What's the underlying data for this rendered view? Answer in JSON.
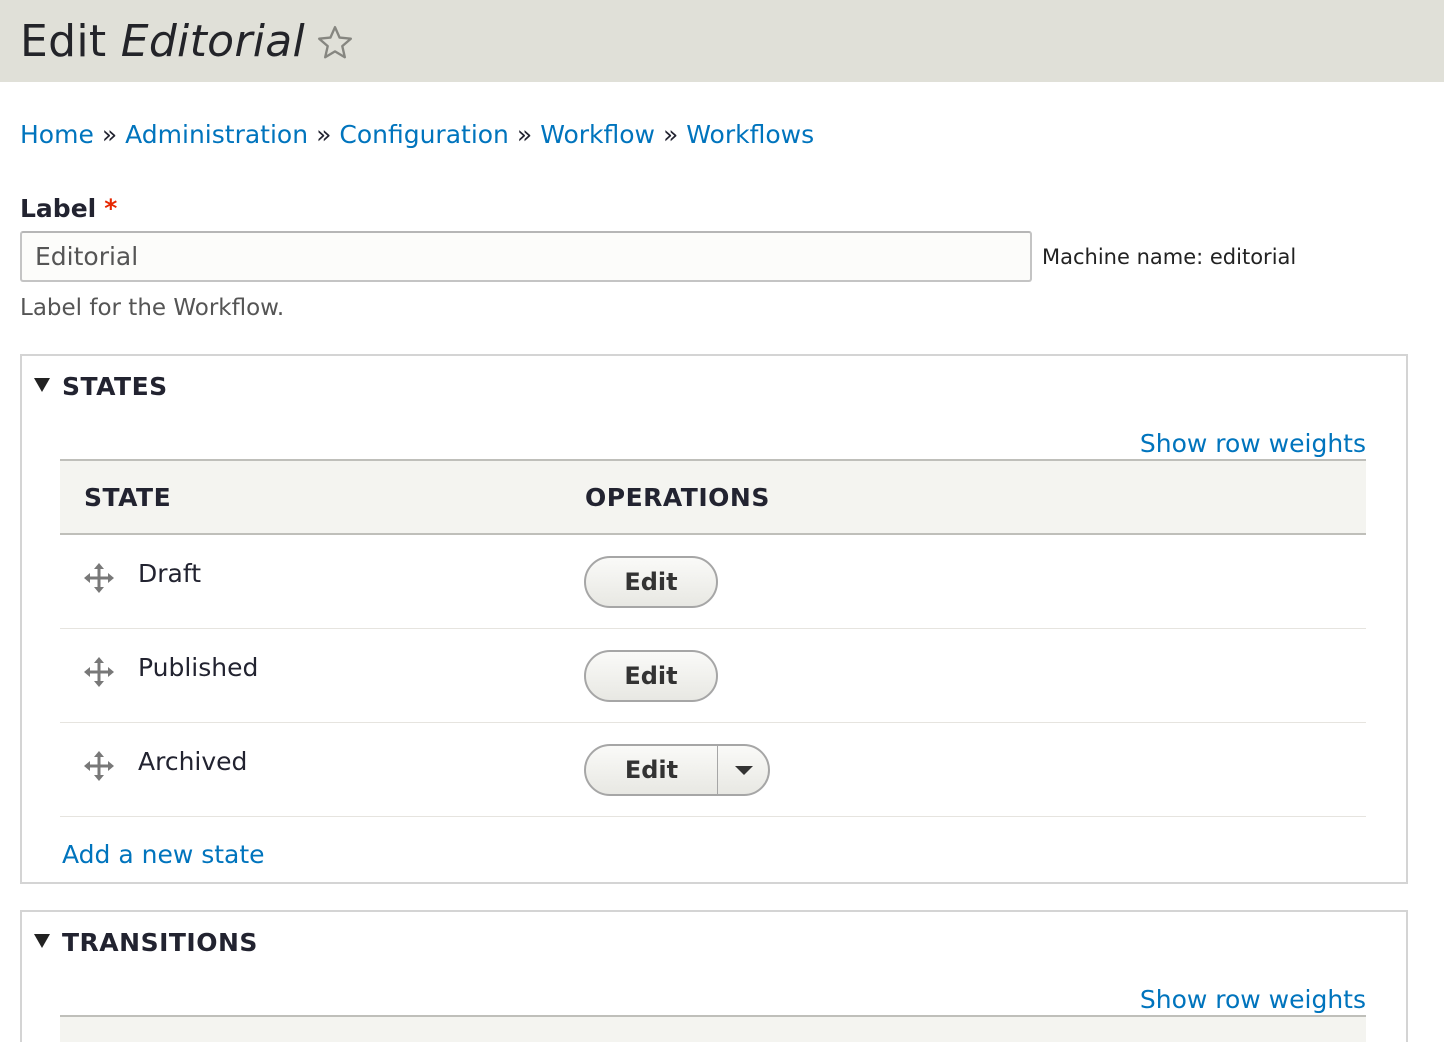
{
  "header": {
    "title_prefix": "Edit",
    "title_emphasis": "Editorial"
  },
  "breadcrumb": [
    "Home",
    "Administration",
    "Configuration",
    "Workflow",
    "Workflows"
  ],
  "breadcrumb_separator": "»",
  "form": {
    "label_field": {
      "label": "Label",
      "required_mark": "*",
      "value": "Editorial",
      "machine_name": "Machine name: editorial",
      "description": "Label for the Workflow."
    }
  },
  "states": {
    "legend": "STATES",
    "show_row_weights": "Show row weights",
    "columns": [
      "STATE",
      "OPERATIONS"
    ],
    "rows": [
      {
        "name": "Draft",
        "operation": "Edit"
      },
      {
        "name": "Published",
        "operation": "Edit"
      },
      {
        "name": "Archived",
        "operation": "Edit"
      }
    ],
    "add_link": "Add a new state"
  },
  "transitions": {
    "legend": "TRANSITIONS",
    "show_row_weights": "Show row weights"
  },
  "colors": {
    "link": "#0074bd",
    "header_bg": "#e0e0d8",
    "required": "#e62600"
  },
  "icons": [
    "star-icon",
    "triangle-down-icon",
    "drag-handle-icon",
    "caret-down-icon"
  ]
}
